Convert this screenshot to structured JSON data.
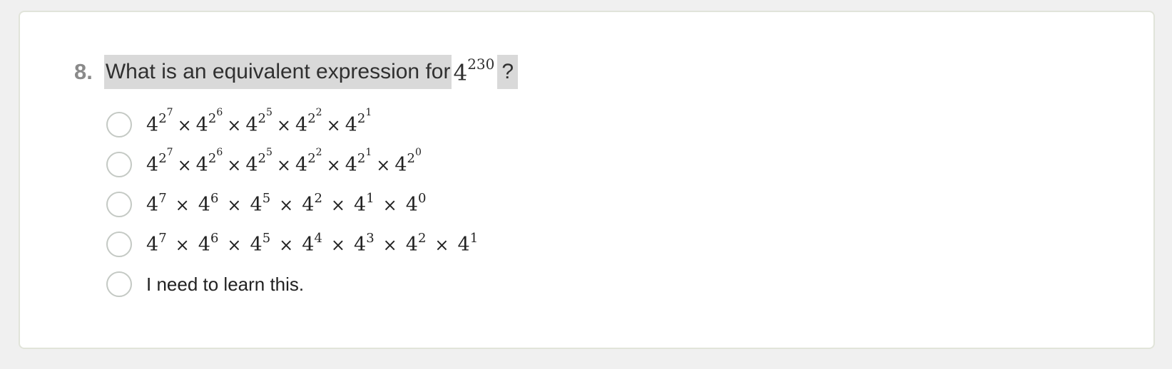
{
  "question": {
    "number": "8.",
    "text": "What is an equivalent expression for",
    "math_base": "4",
    "math_exp": "230",
    "mark": "?"
  },
  "options": [
    {
      "kind": "tower",
      "terms": [
        {
          "base": "4",
          "exp": "2",
          "exp2": "7"
        },
        {
          "base": "4",
          "exp": "2",
          "exp2": "6"
        },
        {
          "base": "4",
          "exp": "2",
          "exp2": "5"
        },
        {
          "base": "4",
          "exp": "2",
          "exp2": "2"
        },
        {
          "base": "4",
          "exp": "2",
          "exp2": "1"
        }
      ]
    },
    {
      "kind": "tower",
      "terms": [
        {
          "base": "4",
          "exp": "2",
          "exp2": "7"
        },
        {
          "base": "4",
          "exp": "2",
          "exp2": "6"
        },
        {
          "base": "4",
          "exp": "2",
          "exp2": "5"
        },
        {
          "base": "4",
          "exp": "2",
          "exp2": "2"
        },
        {
          "base": "4",
          "exp": "2",
          "exp2": "1"
        },
        {
          "base": "4",
          "exp": "2",
          "exp2": "0"
        }
      ]
    },
    {
      "kind": "power",
      "terms": [
        {
          "base": "4",
          "exp": "7"
        },
        {
          "base": "4",
          "exp": "6"
        },
        {
          "base": "4",
          "exp": "5"
        },
        {
          "base": "4",
          "exp": "2"
        },
        {
          "base": "4",
          "exp": "1"
        },
        {
          "base": "4",
          "exp": "0"
        }
      ]
    },
    {
      "kind": "power",
      "terms": [
        {
          "base": "4",
          "exp": "7"
        },
        {
          "base": "4",
          "exp": "6"
        },
        {
          "base": "4",
          "exp": "5"
        },
        {
          "base": "4",
          "exp": "4"
        },
        {
          "base": "4",
          "exp": "3"
        },
        {
          "base": "4",
          "exp": "2"
        },
        {
          "base": "4",
          "exp": "1"
        }
      ]
    },
    {
      "kind": "text",
      "label": "I need to learn this."
    }
  ],
  "times_symbol": "×"
}
